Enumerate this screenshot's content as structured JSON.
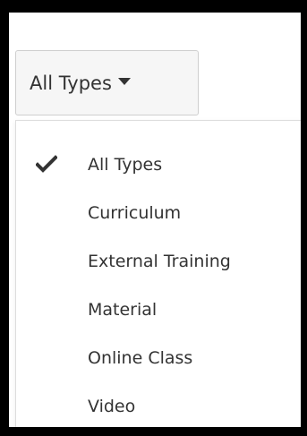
{
  "type_filter": {
    "selected_label": "All Types",
    "caret_icon": "caret-down-icon",
    "options": [
      {
        "label": "All Types",
        "selected": true,
        "icon": "check-icon"
      },
      {
        "label": "Curriculum",
        "selected": false
      },
      {
        "label": "External Training",
        "selected": false
      },
      {
        "label": "Material",
        "selected": false
      },
      {
        "label": "Online Class",
        "selected": false
      },
      {
        "label": "Video",
        "selected": false
      }
    ]
  },
  "colors": {
    "text": "#333333",
    "button_bg": "#f6f6f6",
    "border": "#cfcfcf",
    "frame": "#000000"
  }
}
